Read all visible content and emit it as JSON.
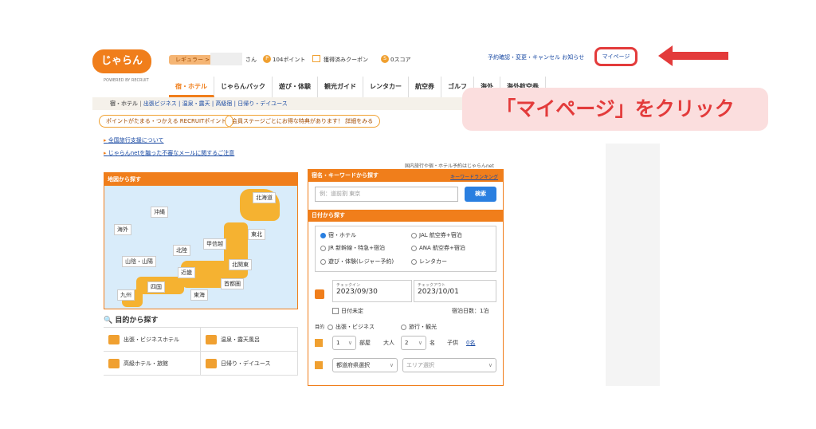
{
  "header": {
    "logo": "じゃらん",
    "logo_sub": "POWERED BY RECRUIT",
    "rank": "レギュラー >",
    "san": "さん",
    "points": "104ポイント",
    "coupon": "獲得済みクーポン",
    "score": "0スコア",
    "top_links": "予約確認・変更・キャンセル  お知らせ",
    "mypage": "マイページ"
  },
  "nav": {
    "items": [
      "宿・ホテル",
      "じゃらんパック",
      "遊び・体験",
      "観光ガイド",
      "レンタカー",
      "航空券",
      "ゴルフ",
      "海外",
      "海外航空券"
    ],
    "sub": "宿・ホテル",
    "sub_links": "出張ビジネス | 温泉・露天 | 高級宿 | 日帰り・デイユース"
  },
  "pills": {
    "left": "ポイントがたまる・つかえる RECRUITポイント",
    "right": "会員ステージごとにお得な特典があります！ 詳細をみる"
  },
  "notices": [
    "全国旅行支援について",
    "じゃらんnetを騙った不審なメールに関するご注意"
  ],
  "note_right": "国内旅行や宿・ホテル予約はじゃらんnet",
  "map": {
    "header": "地図から探す",
    "regions": [
      "北海道",
      "沖縄",
      "東北",
      "海外",
      "甲信越",
      "北陸",
      "北関東",
      "山陰・山陽",
      "近畿",
      "首都圏",
      "四国",
      "東海",
      "九州"
    ]
  },
  "purpose": {
    "header": "目的から探す",
    "items": [
      "出張・ビジネスホテル",
      "温泉・露天風呂",
      "高級ホテル・旅館",
      "日帰り・デイユース"
    ]
  },
  "search": {
    "kw_header": "宿名・キーワードから探す",
    "ranking": "キーワードランキング",
    "placeholder": "例：道前割 東京",
    "button": "検索",
    "date_header": "日付から探す",
    "opts": [
      "宿・ホテル",
      "JAL 航空券+宿泊",
      "JR 新幹線・特急+宿泊",
      "ANA 航空券+宿泊",
      "遊び・体験(レジャー予約)",
      "レンタカー"
    ],
    "checkin_label": "チェックイン",
    "checkin": "2023/09/30",
    "checkout_label": "チェックアウト",
    "checkout": "2023/10/01",
    "undecided": "日付未定",
    "nights": "宿泊日数：1泊",
    "purpose_label": "目的",
    "biz": "出張・ビジネス",
    "travel": "旅行・観光",
    "rooms": "1",
    "room_unit": "部屋",
    "adult_label": "大人",
    "adults": "2",
    "adult_unit": "名",
    "child_label": "子供",
    "children": "0名",
    "pref": "都道府県選択",
    "area": "エリア選択"
  },
  "annotation": {
    "callout": "「マイページ」をクリック",
    "arrow_color": "#e33b3b"
  }
}
